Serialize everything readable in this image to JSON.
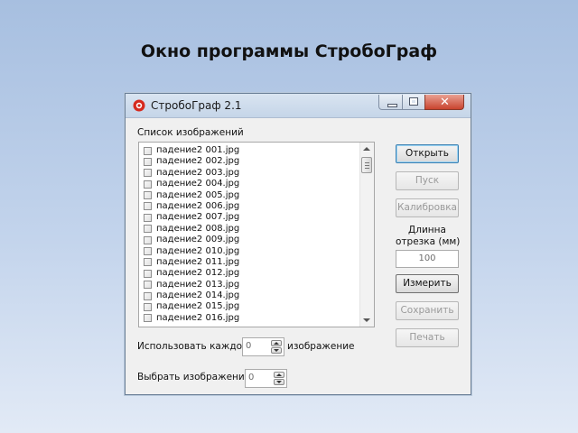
{
  "slide": {
    "title": "Окно программы СтробоГраф"
  },
  "window": {
    "title": "СтробоГраф 2.1",
    "close_glyph": "✕"
  },
  "list": {
    "label": "Список изображений",
    "items": [
      "падение2 001.jpg",
      "падение2 002.jpg",
      "падение2 003.jpg",
      "падение2 004.jpg",
      "падение2 005.jpg",
      "падение2 006.jpg",
      "падение2 007.jpg",
      "падение2 008.jpg",
      "падение2 009.jpg",
      "падение2 010.jpg",
      "падение2 011.jpg",
      "падение2 012.jpg",
      "падение2 013.jpg",
      "падение2 014.jpg",
      "падение2 015.jpg",
      "падение2 016.jpg"
    ]
  },
  "buttons": {
    "open": "Открыть",
    "start": "Пуск",
    "calibrate": "Калибровка",
    "measure": "Измерить",
    "save": "Сохранить",
    "print": "Печать"
  },
  "segment": {
    "label_line1": "Длинна",
    "label_line2": "отрезка (мм)",
    "value": "100"
  },
  "use_every": {
    "prefix": "Использовать каждое",
    "value": "0",
    "suffix": "изображение"
  },
  "select_count": {
    "label": "Выбрать изображений:",
    "value": "0"
  },
  "colors": {
    "default_button_border": "#3c7fb1",
    "disabled_text": "#9a9a9a"
  },
  "icons": {
    "app": "app-logo-icon",
    "minimize": "minimize-icon",
    "maximize": "maximize-icon",
    "close": "close-icon"
  }
}
